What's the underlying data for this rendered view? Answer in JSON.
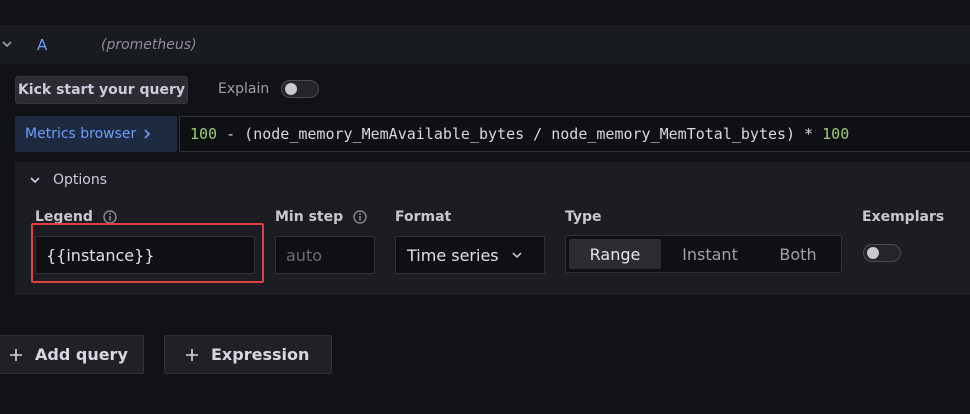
{
  "query": {
    "ref_id": "A",
    "datasource": "(prometheus)"
  },
  "toolbar": {
    "kick_start_label": "Kick start your query",
    "explain_label": "Explain",
    "explain_enabled": false
  },
  "editor": {
    "metrics_browser_label": "Metrics browser",
    "expr_prefix": "100",
    "expr_middle": " - (node_memory_MemAvailable_bytes / node_memory_MemTotal_bytes) * ",
    "expr_suffix": "100"
  },
  "options": {
    "header_label": "Options",
    "legend_label": "Legend",
    "legend_value": "{{instance}}",
    "min_step_label": "Min step",
    "min_step_placeholder": "auto",
    "format_label": "Format",
    "format_value": "Time series",
    "type_label": "Type",
    "type_options": [
      "Range",
      "Instant",
      "Both"
    ],
    "type_selected": "Range",
    "exemplars_label": "Exemplars",
    "exemplars_enabled": false
  },
  "actions": {
    "add_query_label": "Add query",
    "expression_label": "Expression"
  },
  "colors": {
    "accent": "#6e9fff",
    "highlight": "#e0413f",
    "number": "#9ccc7a"
  },
  "icons": {
    "collapse": "chevron-down-icon",
    "metrics": "chevron-right-icon",
    "info": "info-icon",
    "format": "chevron-down-icon",
    "add": "plus-icon"
  }
}
